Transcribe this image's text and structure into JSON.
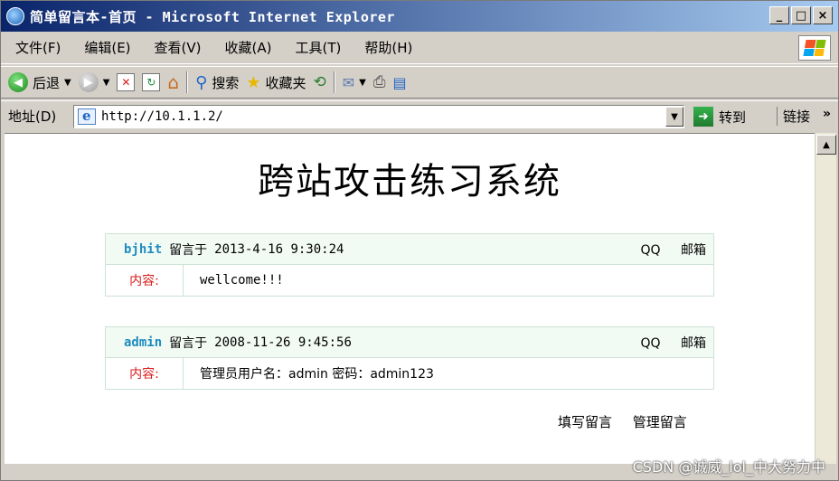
{
  "window": {
    "title": "简单留言本-首页 - Microsoft Internet Explorer"
  },
  "window_buttons": {
    "minimize": "_",
    "maximize": "□",
    "close": "×"
  },
  "menu": [
    "文件(F)",
    "编辑(E)",
    "查看(V)",
    "收藏(A)",
    "工具(T)",
    "帮助(H)"
  ],
  "toolbar": {
    "back": "后退",
    "search": "搜索",
    "favorites": "收藏夹"
  },
  "address": {
    "label": "地址(D)",
    "url": "http://10.1.1.2/",
    "go": "转到",
    "links": "链接",
    "more": "»"
  },
  "page": {
    "title": "跨站攻击练习系统",
    "messages": [
      {
        "author": "bjhit",
        "said": "留言于",
        "time": "2013-4-16 9:30:24",
        "qq": "QQ",
        "mail": "邮箱",
        "content_label": "内容:",
        "content": "wellcome!!!"
      },
      {
        "author": "admin",
        "said": "留言于",
        "time": "2008-11-26 9:45:56",
        "qq": "QQ",
        "mail": "邮箱",
        "content_label": "内容:",
        "content": "管理员用户名：admin 密码：admin123"
      }
    ],
    "links": {
      "write": "填写留言",
      "manage": "管理留言"
    }
  },
  "watermark": "CSDN @诚威_lol_中大努力中",
  "colors": {
    "title_bar": "#0a246a",
    "author": "#1f8cc0",
    "content_label": "#d81b1b",
    "msg_border": "#cde2d4"
  }
}
